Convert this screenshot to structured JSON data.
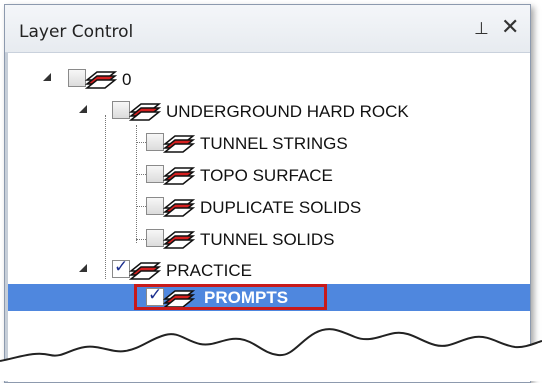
{
  "window": {
    "title": "Layer Control",
    "pin_glyph": "⊥",
    "close_glyph": "✕"
  },
  "layers": [
    {
      "label": "0",
      "checked": false,
      "expanded": true
    },
    {
      "label": "UNDERGROUND HARD ROCK",
      "checked": false,
      "expanded": true
    },
    {
      "label": "TUNNEL STRINGS",
      "checked": false
    },
    {
      "label": "TOPO SURFACE",
      "checked": false
    },
    {
      "label": "DUPLICATE SOLIDS",
      "checked": false
    },
    {
      "label": "TUNNEL SOLIDS",
      "checked": false
    },
    {
      "label": "PRACTICE",
      "checked": true,
      "expanded": true
    },
    {
      "label": "PROMPTS",
      "checked": true,
      "selected": true
    }
  ],
  "colors": {
    "selection": "#4f87de",
    "highlight_border": "#c81a1a",
    "layer_icon_red": "#d62020",
    "check_mark": "#1c2f8f"
  },
  "icons": {
    "expand": "expanded-triangle-icon",
    "layer": "layer-stack-icon",
    "pin": "pin-icon",
    "close": "close-icon"
  }
}
